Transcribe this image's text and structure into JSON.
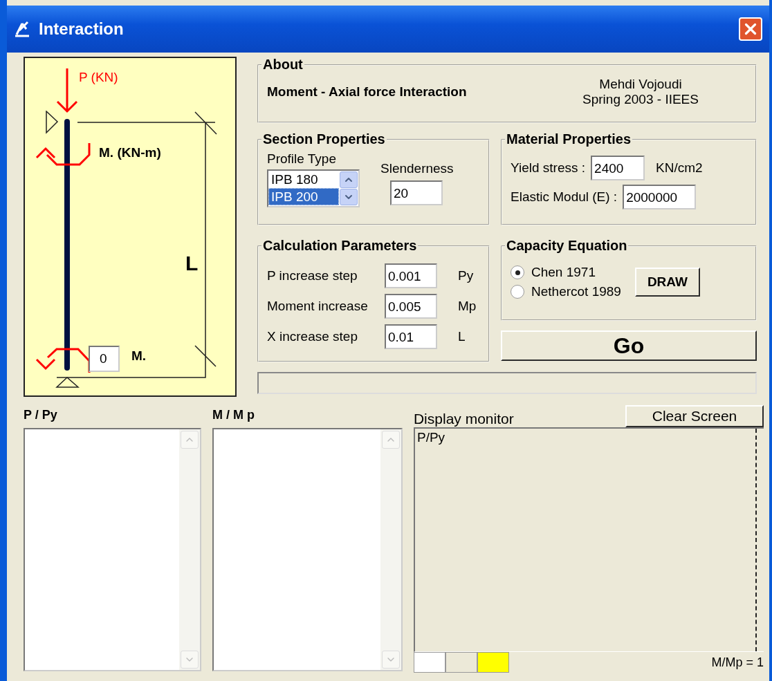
{
  "window": {
    "title": "Interaction"
  },
  "diagram": {
    "load_label": "P (KN)",
    "top_moment_label": "M. (KN-m)",
    "length_label": "L",
    "bottom_moment_value": "0",
    "bottom_moment_label": "M."
  },
  "about": {
    "title": "About",
    "heading": "Moment - Axial force Interaction",
    "author": "Mehdi Vojoudi",
    "credit": "Spring 2003  - IIEES"
  },
  "section_properties": {
    "title": "Section Properties",
    "profile_label": "Profile Type",
    "profiles": [
      {
        "label": "IPB 180",
        "selected": false
      },
      {
        "label": "IPB 200",
        "selected": true
      }
    ],
    "slenderness_label": "Slenderness",
    "slenderness": "20"
  },
  "material_properties": {
    "title": "Material Properties",
    "fields": [
      {
        "label": "Yield stress :",
        "value": "2400",
        "unit": "KN/cm2"
      },
      {
        "label": "Elastic Modul (E) :",
        "value": "2000000"
      }
    ]
  },
  "calculation_parameters": {
    "title": "Calculation Parameters",
    "fields": [
      {
        "label": "P increase step",
        "value": "0.001",
        "unit": "Py"
      },
      {
        "label": "Moment increase",
        "value": "0.005",
        "unit": "Mp"
      },
      {
        "label": "X increase step",
        "value": "0.01",
        "unit": "L"
      }
    ]
  },
  "capacity_equation": {
    "title": "Capacity Equation",
    "options": [
      {
        "label": "Chen 1971",
        "selected": true
      },
      {
        "label": "Nethercot 1989",
        "selected": false
      }
    ],
    "draw_button": "DRAW"
  },
  "go_button": "Go",
  "lists": [
    {
      "title": "P / Py"
    },
    {
      "title": "M / M p"
    }
  ],
  "monitor": {
    "title": "Display monitor",
    "clear_button": "Clear Screen",
    "axis_label": "P/Py",
    "scale_label": "M/Mp = 1",
    "swatches": [
      {
        "color": "#ffffff"
      },
      {
        "color": "#ece9d8"
      },
      {
        "color": "#ffff00"
      }
    ]
  }
}
